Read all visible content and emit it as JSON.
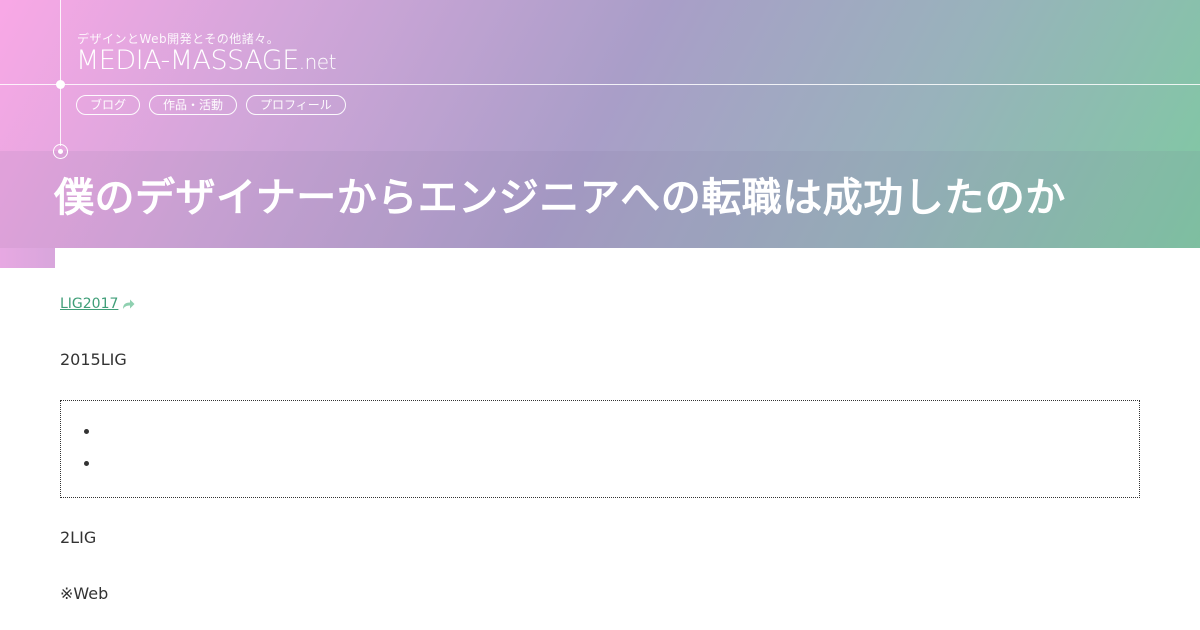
{
  "site": {
    "tagline": "デザインとWeb開発とその他諸々。",
    "title_main": "MEDIA-MASSAGE",
    "title_tld": ".net"
  },
  "nav": {
    "items": [
      "ブログ",
      "作品・活動",
      "プロフィール"
    ]
  },
  "article": {
    "title": "僕のデザイナーからエンジニアへの転職は成功したのか",
    "tag": "LIG2017",
    "paragraph1": "2015LIG",
    "toc_items": [
      "",
      ""
    ],
    "paragraph2": "2LIG",
    "paragraph3": "※Web"
  },
  "colors": {
    "accent_link": "#3f9e78",
    "hero_gradient_start": "#f9a8e6",
    "hero_gradient_end": "#7fc9a2"
  },
  "icons": [
    "share-arrow-icon"
  ]
}
